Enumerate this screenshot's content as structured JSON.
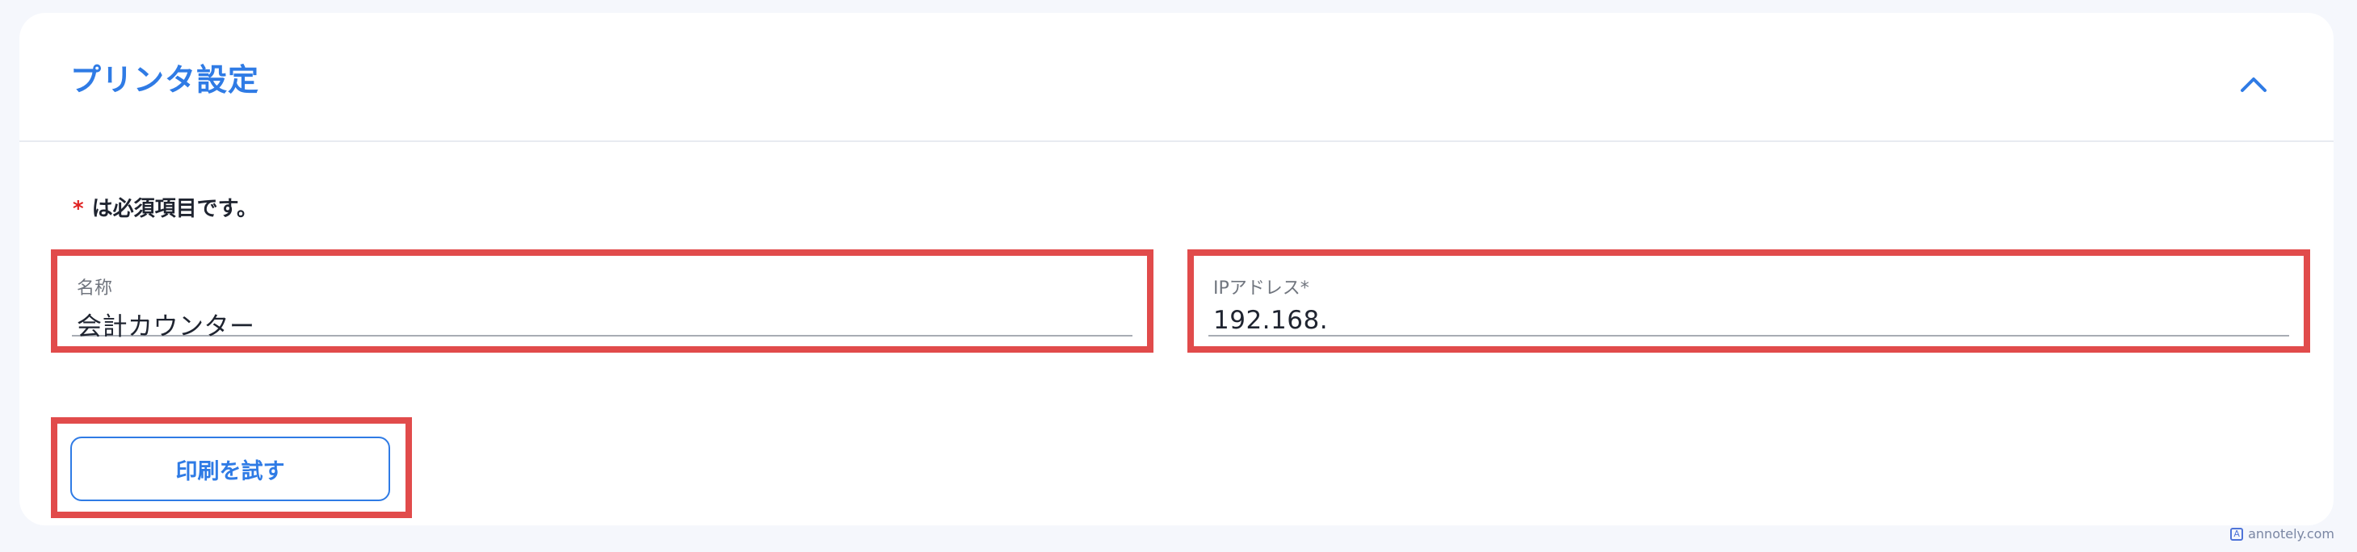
{
  "card": {
    "title": "プリンタ設定",
    "collapse_icon": "chevron-up-icon"
  },
  "required_note": {
    "star": "*",
    "text": "は必須項目です。"
  },
  "fields": {
    "name": {
      "label": "名称",
      "value": "会計カウンター"
    },
    "ip_address": {
      "label": "IPアドレス*",
      "value": "192.168."
    }
  },
  "actions": {
    "test_print_label": "印刷を試す"
  },
  "watermark": {
    "text": "annotely.com"
  },
  "colors": {
    "accent": "#2f7be5",
    "highlight_border": "#e14b4b",
    "required": "#e02424"
  }
}
